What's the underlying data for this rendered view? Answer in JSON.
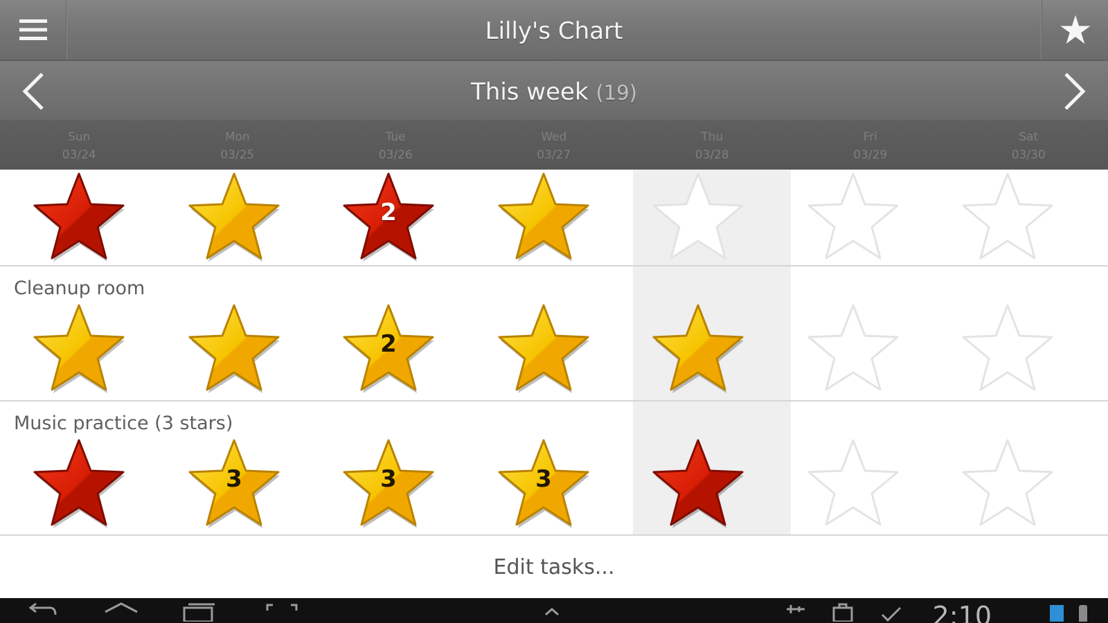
{
  "app": {
    "title": "Lilly's Chart"
  },
  "week": {
    "title": "This week",
    "count": "(19)"
  },
  "days": [
    {
      "name": "Sun",
      "date": "03/24"
    },
    {
      "name": "Mon",
      "date": "03/25"
    },
    {
      "name": "Tue",
      "date": "03/26"
    },
    {
      "name": "Wed",
      "date": "03/27"
    },
    {
      "name": "Thu",
      "date": "03/28"
    },
    {
      "name": "Fri",
      "date": "03/29"
    },
    {
      "name": "Sat",
      "date": "03/30"
    }
  ],
  "tasks": [
    {
      "label": "",
      "stars": [
        "red",
        "gold",
        "red",
        "gold",
        "empty",
        "empty",
        "empty"
      ],
      "numbers": [
        "",
        "",
        "2",
        "",
        "",
        "",
        ""
      ]
    },
    {
      "label": "Cleanup room",
      "stars": [
        "gold",
        "gold",
        "gold",
        "gold",
        "gold",
        "empty",
        "empty"
      ],
      "numbers": [
        "",
        "",
        "2",
        "",
        "",
        "",
        ""
      ]
    },
    {
      "label": "Music practice (3 stars)",
      "stars": [
        "red",
        "gold",
        "gold",
        "gold",
        "red",
        "empty",
        "empty"
      ],
      "numbers": [
        "",
        "3",
        "3",
        "3",
        "",
        "",
        ""
      ]
    }
  ],
  "footer": {
    "edit_label": "Edit tasks..."
  },
  "status_bar": {
    "clock": "2:10"
  },
  "colors": {
    "gold": "#f6c400",
    "red": "#d81e05",
    "highlight_column": "#efefef"
  },
  "icons": {
    "menu": "menu-icon",
    "favorite": "star-icon",
    "prev": "chevron-left-icon",
    "next": "chevron-right-icon"
  }
}
